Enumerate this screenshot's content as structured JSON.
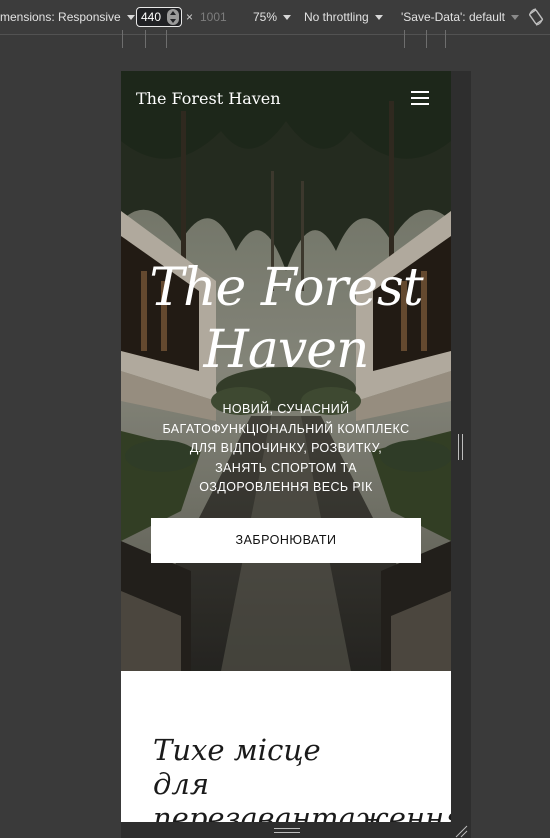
{
  "devtools": {
    "dimensions_label": "mensions: Responsive",
    "width_value": "440",
    "times_sign": "×",
    "height_value": "1001",
    "zoom": "75%",
    "throttling": "No throttling",
    "save_data": "'Save-Data': default"
  },
  "site": {
    "brand": "The Forest Haven",
    "hero_title_line1": "The Forest",
    "hero_title_line2": "Haven",
    "hero_sub_line1": "НОВИЙ, СУЧАСНИЙ",
    "hero_sub_line2": "БАГАТОФУНКЦІОНАЛЬНИЙ КОМПЛЕКС",
    "hero_sub_line3": "ДЛЯ ВІДПОЧИНКУ, РОЗВИТКУ,",
    "hero_sub_line4": "ЗАНЯТЬ СПОРТОМ ТА",
    "hero_sub_line5": "ОЗДОРОВЛЕННЯ ВЕСЬ РІК",
    "cta_label": "ЗАБРОНЮВАТИ",
    "section_title_line1": "Тихе місце",
    "section_title_line2": "для",
    "section_title_line3": "перезавантаження"
  },
  "icons": {
    "menu": "hamburger-menu-icon",
    "rotate": "rotate-device-icon"
  }
}
